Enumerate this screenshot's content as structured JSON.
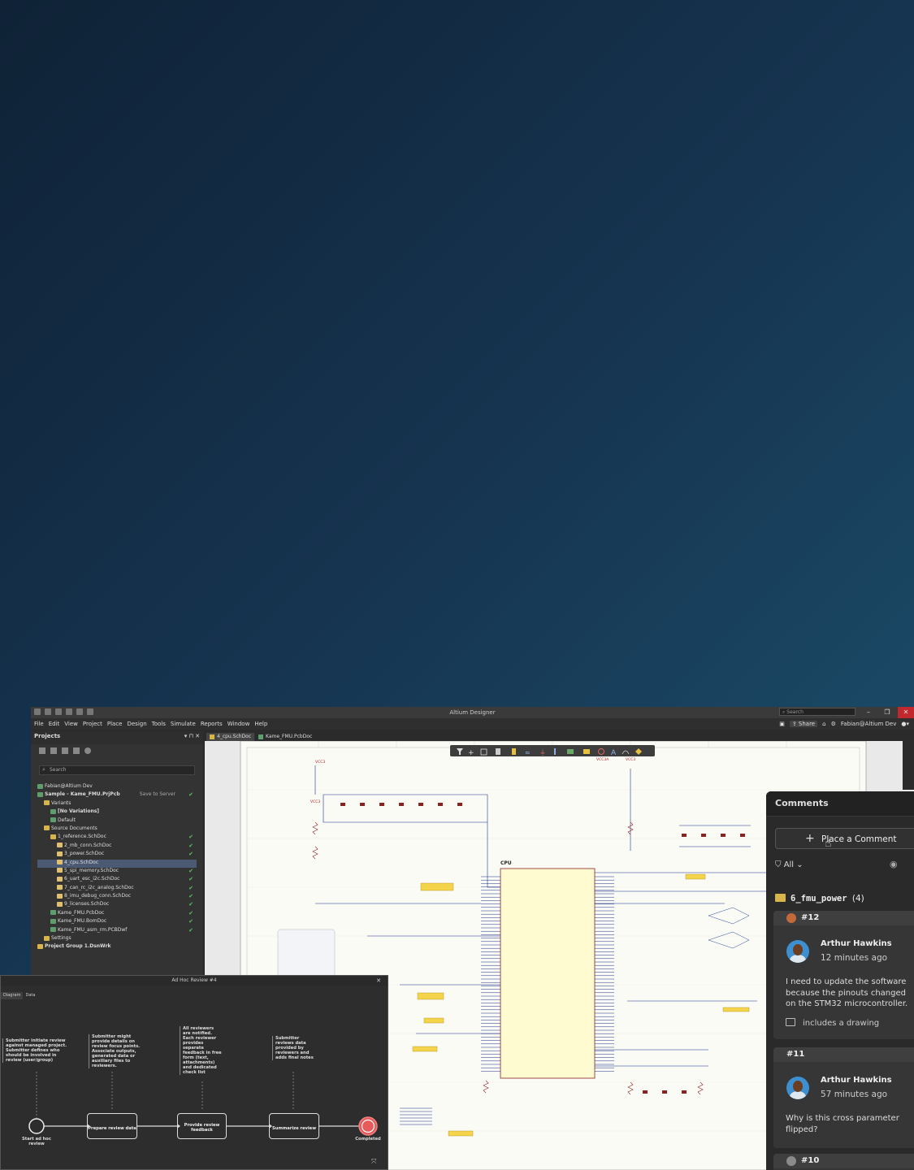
{
  "app": {
    "title": "Altium Designer",
    "search_placeholder": "Search",
    "menu": [
      "File",
      "Edit",
      "View",
      "Project",
      "Place",
      "Design",
      "Tools",
      "Simulate",
      "Reports",
      "Window",
      "Help"
    ],
    "share_label": "Share",
    "user": "Fabian@Altium Dev"
  },
  "projects": {
    "title": "Projects",
    "search_placeholder": "Search",
    "tree": [
      {
        "label": "Fabian@Altium Dev",
        "level": 0,
        "icon": "cloud",
        "status": ""
      },
      {
        "label": "Sample - Kame_FMU.PrjPcb",
        "level": 0,
        "icon": "project",
        "bold": true,
        "extra": "Save to Server",
        "status": "✔"
      },
      {
        "label": "Variants",
        "level": 1,
        "icon": "folder",
        "status": ""
      },
      {
        "label": "[No Variations]",
        "level": 2,
        "icon": "pcb",
        "bold": true,
        "status": ""
      },
      {
        "label": "Default",
        "level": 2,
        "icon": "pcb",
        "status": ""
      },
      {
        "label": "Source Documents",
        "level": 1,
        "icon": "folder",
        "status": ""
      },
      {
        "label": "1_reference.SchDoc",
        "level": 2,
        "icon": "folder",
        "status": "✔"
      },
      {
        "label": "2_mb_conn.SchDoc",
        "level": 3,
        "icon": "doc",
        "status": "✔"
      },
      {
        "label": "3_power.SchDoc",
        "level": 3,
        "icon": "doc",
        "status": "✔"
      },
      {
        "label": "4_cpu.SchDoc",
        "level": 3,
        "icon": "doc",
        "status": "",
        "selected": true
      },
      {
        "label": "5_spi_memory.SchDoc",
        "level": 3,
        "icon": "doc",
        "status": "✔"
      },
      {
        "label": "6_uart_esc_i2c.SchDoc",
        "level": 3,
        "icon": "doc",
        "status": "✔"
      },
      {
        "label": "7_can_rc_i2c_analog.SchDoc",
        "level": 3,
        "icon": "doc",
        "status": "✔"
      },
      {
        "label": "8_imu_debug_conn.SchDoc",
        "level": 3,
        "icon": "doc",
        "status": "✔"
      },
      {
        "label": "9_licenses.SchDoc",
        "level": 3,
        "icon": "doc",
        "status": "✔"
      },
      {
        "label": "Kame_FMU.PcbDoc",
        "level": 2,
        "icon": "pcb",
        "status": "✔"
      },
      {
        "label": "Kame_FMU.BomDoc",
        "level": 2,
        "icon": "pcb",
        "status": "✔"
      },
      {
        "label": "Kame_FMU_asm_rm.PCBDwf",
        "level": 2,
        "icon": "pcb",
        "status": "✔"
      },
      {
        "label": "Settings",
        "level": 1,
        "icon": "folder",
        "status": ""
      },
      {
        "label": "Project Group 1.DsnWrk",
        "level": 0,
        "icon": "folder",
        "bold": true,
        "status": ""
      }
    ]
  },
  "tabs": [
    {
      "label": "4_cpu.SchDoc",
      "active": true
    },
    {
      "label": "Kame_FMU.PcbDoc",
      "active": false
    }
  ],
  "schematic": {
    "cpu_label": "CPU",
    "nets": [
      "VCC3",
      "VCC3A",
      "VCC3",
      "VCC3"
    ]
  },
  "review": {
    "title": "Ad Hoc Review #4",
    "tabs": [
      "Diagram",
      "Data"
    ],
    "notes": [
      "Submitter initiate review against managed project. Submitter defines who should be involved in review (user/group)",
      "Submitter might provide details on review focus points. Associate outputs, generated data or auxiliary files to reviewers.",
      "All reviewers are notified. Each reviewer provides separate feedback in free form (text, attachments) and dedicated check list",
      "Submitter reviews data provided by reviewers and adds final notes"
    ],
    "start_label": "Start ad hoc review",
    "steps": [
      "Prepare review data",
      "Provide review feedback",
      "Summarize review"
    ],
    "end_label": "Completed"
  },
  "comments": {
    "title": "Comments",
    "place_label": "Place a Comment",
    "filter_label": "All",
    "folder": {
      "name": "6_fmu_power",
      "count": "(4)"
    },
    "threads": [
      {
        "id": "#12",
        "author": "Arthur Hawkins",
        "time": "12 minutes ago",
        "text": "I need to update the software because the pinouts changed on the STM32 microcontroller.",
        "attachment": "includes a drawing"
      },
      {
        "id": "#11",
        "author": "Arthur Hawkins",
        "time": "57 minutes ago",
        "text": "Why is this cross parameter flipped?"
      },
      {
        "id": "#10"
      }
    ]
  }
}
